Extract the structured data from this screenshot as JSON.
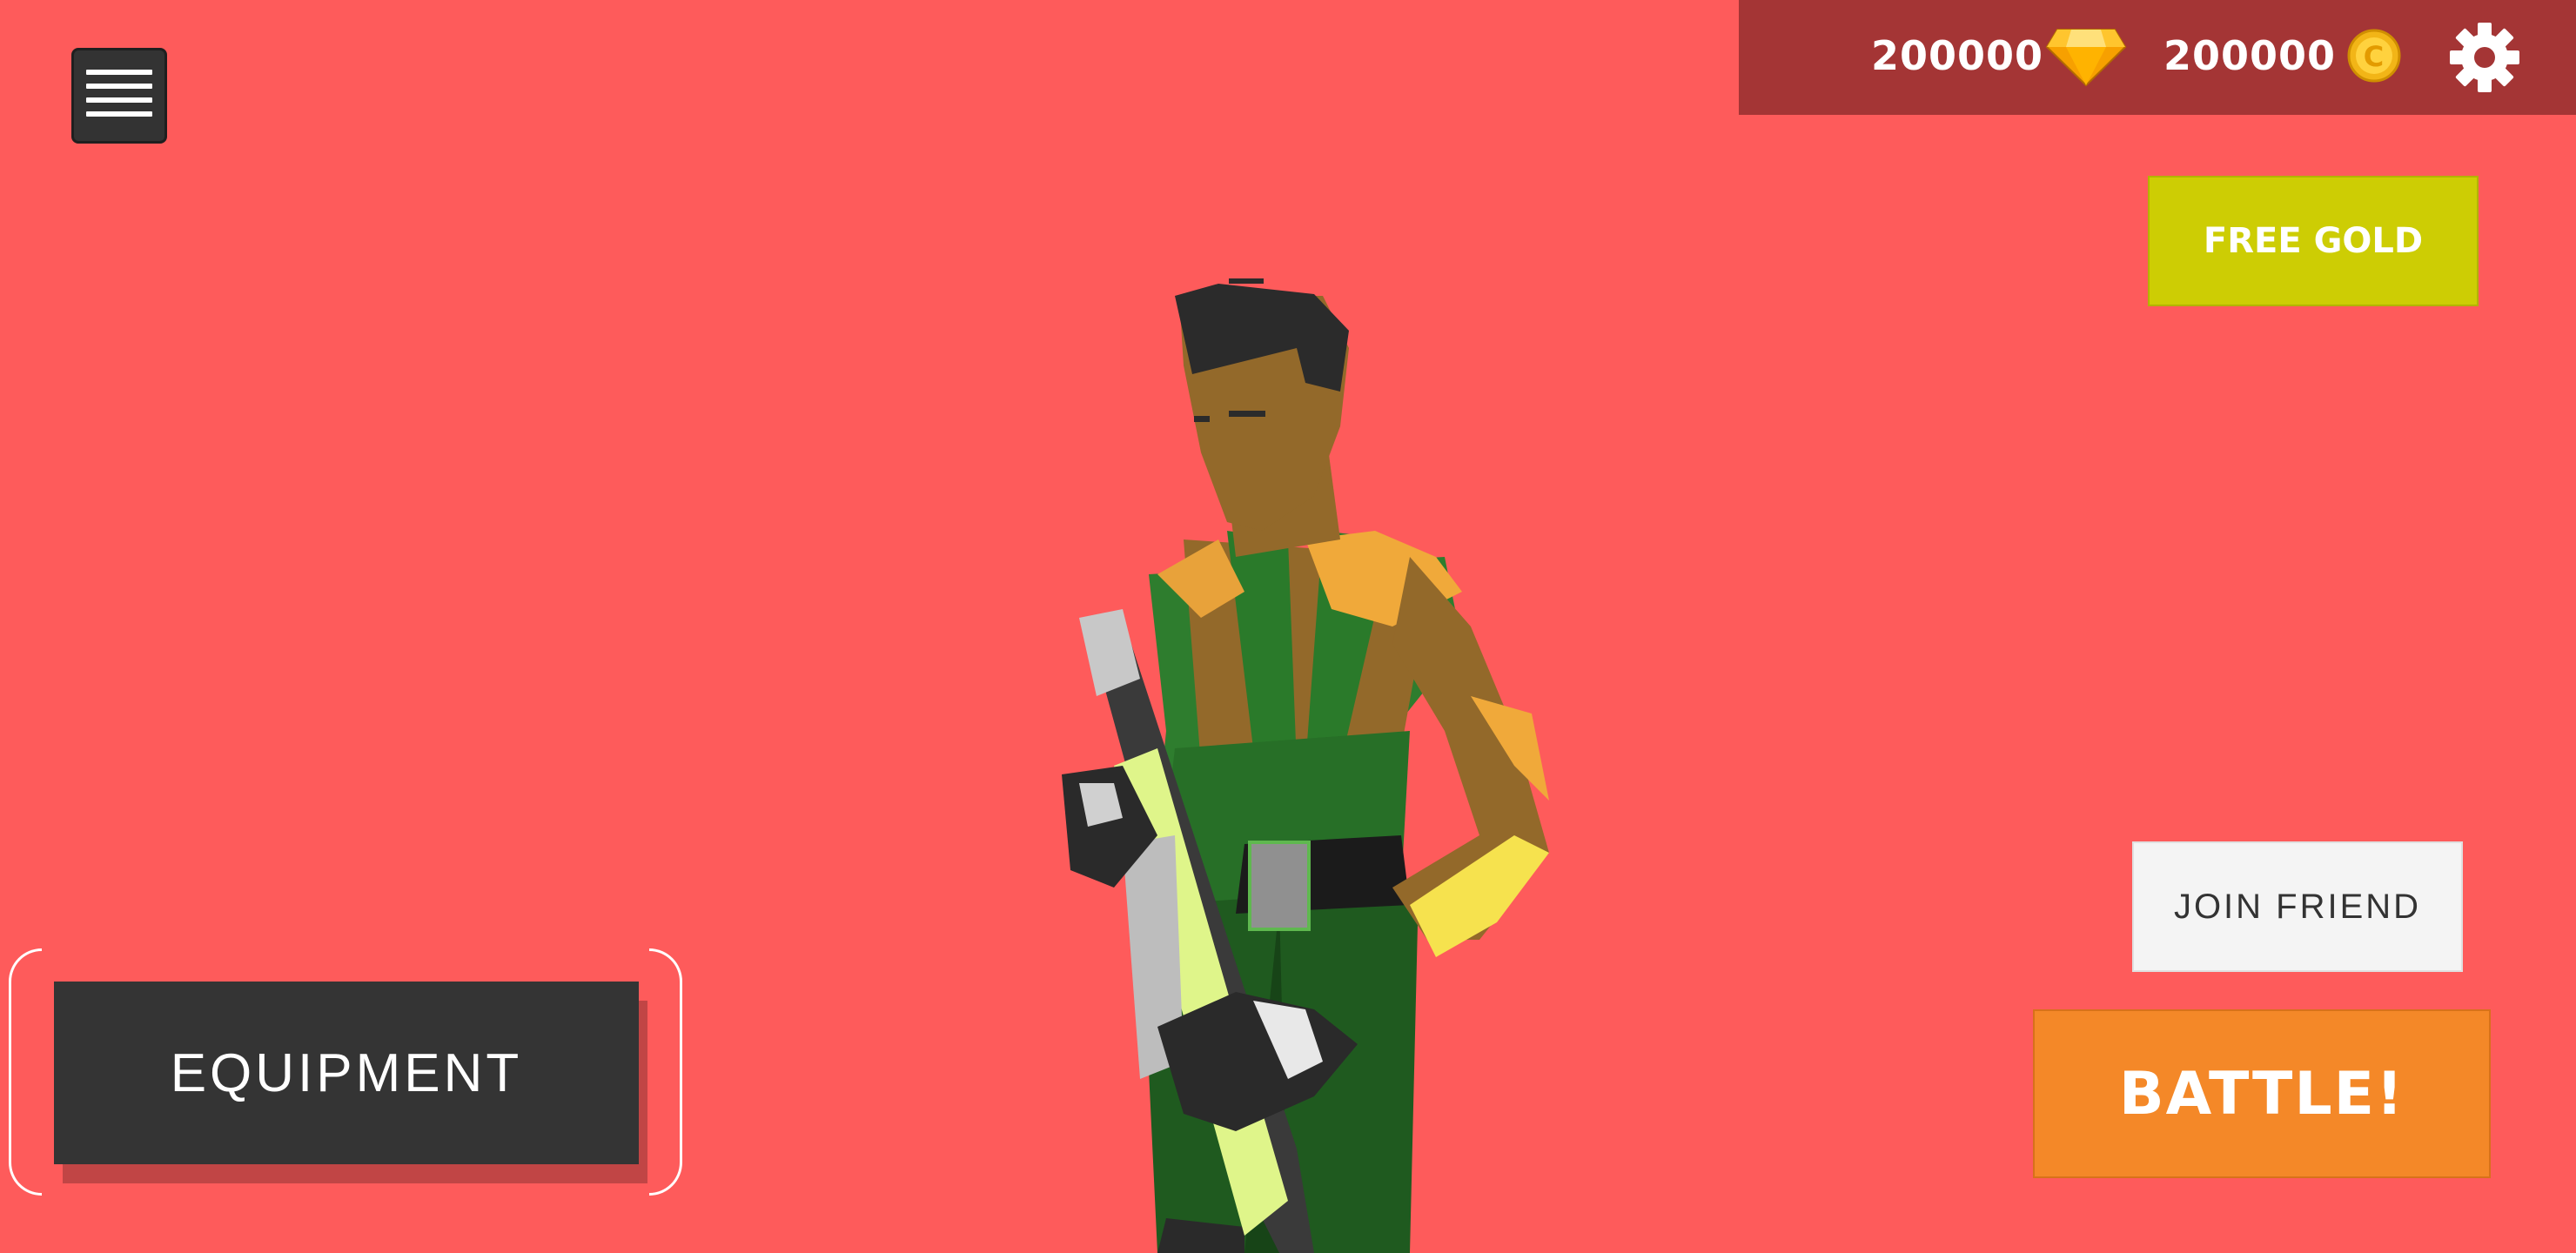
{
  "hud": {
    "gems": {
      "amount": "200000",
      "icon": "diamond-icon"
    },
    "gold": {
      "amount": "200000",
      "icon": "gold-coin-icon"
    },
    "settings_icon": "gear-icon",
    "menu_icon": "hamburger-menu-icon"
  },
  "buttons": {
    "free_gold": "FREE GOLD",
    "join_friend": "JOIN FRIEND",
    "battle": "BATTLE!",
    "equipment": "EQUIPMENT"
  },
  "colors": {
    "background": "#fe5b5b",
    "topbar": "#a43535",
    "free_gold": "#cdcd04",
    "battle": "#f48828",
    "equipment": "#343434",
    "join_friend": "#f4f4f4"
  }
}
